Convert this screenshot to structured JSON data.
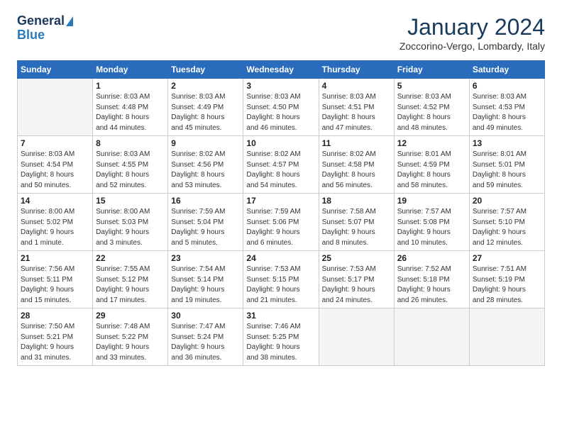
{
  "header": {
    "logo_general": "General",
    "logo_blue": "Blue",
    "month_title": "January 2024",
    "location": "Zoccorino-Vergo, Lombardy, Italy"
  },
  "days_of_week": [
    "Sunday",
    "Monday",
    "Tuesday",
    "Wednesday",
    "Thursday",
    "Friday",
    "Saturday"
  ],
  "weeks": [
    [
      {
        "day": "",
        "empty": true
      },
      {
        "day": "1",
        "info": "Sunrise: 8:03 AM\nSunset: 4:48 PM\nDaylight: 8 hours\nand 44 minutes."
      },
      {
        "day": "2",
        "info": "Sunrise: 8:03 AM\nSunset: 4:49 PM\nDaylight: 8 hours\nand 45 minutes."
      },
      {
        "day": "3",
        "info": "Sunrise: 8:03 AM\nSunset: 4:50 PM\nDaylight: 8 hours\nand 46 minutes."
      },
      {
        "day": "4",
        "info": "Sunrise: 8:03 AM\nSunset: 4:51 PM\nDaylight: 8 hours\nand 47 minutes."
      },
      {
        "day": "5",
        "info": "Sunrise: 8:03 AM\nSunset: 4:52 PM\nDaylight: 8 hours\nand 48 minutes."
      },
      {
        "day": "6",
        "info": "Sunrise: 8:03 AM\nSunset: 4:53 PM\nDaylight: 8 hours\nand 49 minutes."
      }
    ],
    [
      {
        "day": "7",
        "info": "Sunrise: 8:03 AM\nSunset: 4:54 PM\nDaylight: 8 hours\nand 50 minutes."
      },
      {
        "day": "8",
        "info": "Sunrise: 8:03 AM\nSunset: 4:55 PM\nDaylight: 8 hours\nand 52 minutes."
      },
      {
        "day": "9",
        "info": "Sunrise: 8:02 AM\nSunset: 4:56 PM\nDaylight: 8 hours\nand 53 minutes."
      },
      {
        "day": "10",
        "info": "Sunrise: 8:02 AM\nSunset: 4:57 PM\nDaylight: 8 hours\nand 54 minutes."
      },
      {
        "day": "11",
        "info": "Sunrise: 8:02 AM\nSunset: 4:58 PM\nDaylight: 8 hours\nand 56 minutes."
      },
      {
        "day": "12",
        "info": "Sunrise: 8:01 AM\nSunset: 4:59 PM\nDaylight: 8 hours\nand 58 minutes."
      },
      {
        "day": "13",
        "info": "Sunrise: 8:01 AM\nSunset: 5:01 PM\nDaylight: 8 hours\nand 59 minutes."
      }
    ],
    [
      {
        "day": "14",
        "info": "Sunrise: 8:00 AM\nSunset: 5:02 PM\nDaylight: 9 hours\nand 1 minute."
      },
      {
        "day": "15",
        "info": "Sunrise: 8:00 AM\nSunset: 5:03 PM\nDaylight: 9 hours\nand 3 minutes."
      },
      {
        "day": "16",
        "info": "Sunrise: 7:59 AM\nSunset: 5:04 PM\nDaylight: 9 hours\nand 5 minutes."
      },
      {
        "day": "17",
        "info": "Sunrise: 7:59 AM\nSunset: 5:06 PM\nDaylight: 9 hours\nand 6 minutes."
      },
      {
        "day": "18",
        "info": "Sunrise: 7:58 AM\nSunset: 5:07 PM\nDaylight: 9 hours\nand 8 minutes."
      },
      {
        "day": "19",
        "info": "Sunrise: 7:57 AM\nSunset: 5:08 PM\nDaylight: 9 hours\nand 10 minutes."
      },
      {
        "day": "20",
        "info": "Sunrise: 7:57 AM\nSunset: 5:10 PM\nDaylight: 9 hours\nand 12 minutes."
      }
    ],
    [
      {
        "day": "21",
        "info": "Sunrise: 7:56 AM\nSunset: 5:11 PM\nDaylight: 9 hours\nand 15 minutes."
      },
      {
        "day": "22",
        "info": "Sunrise: 7:55 AM\nSunset: 5:12 PM\nDaylight: 9 hours\nand 17 minutes."
      },
      {
        "day": "23",
        "info": "Sunrise: 7:54 AM\nSunset: 5:14 PM\nDaylight: 9 hours\nand 19 minutes."
      },
      {
        "day": "24",
        "info": "Sunrise: 7:53 AM\nSunset: 5:15 PM\nDaylight: 9 hours\nand 21 minutes."
      },
      {
        "day": "25",
        "info": "Sunrise: 7:53 AM\nSunset: 5:17 PM\nDaylight: 9 hours\nand 24 minutes."
      },
      {
        "day": "26",
        "info": "Sunrise: 7:52 AM\nSunset: 5:18 PM\nDaylight: 9 hours\nand 26 minutes."
      },
      {
        "day": "27",
        "info": "Sunrise: 7:51 AM\nSunset: 5:19 PM\nDaylight: 9 hours\nand 28 minutes."
      }
    ],
    [
      {
        "day": "28",
        "info": "Sunrise: 7:50 AM\nSunset: 5:21 PM\nDaylight: 9 hours\nand 31 minutes."
      },
      {
        "day": "29",
        "info": "Sunrise: 7:48 AM\nSunset: 5:22 PM\nDaylight: 9 hours\nand 33 minutes."
      },
      {
        "day": "30",
        "info": "Sunrise: 7:47 AM\nSunset: 5:24 PM\nDaylight: 9 hours\nand 36 minutes."
      },
      {
        "day": "31",
        "info": "Sunrise: 7:46 AM\nSunset: 5:25 PM\nDaylight: 9 hours\nand 38 minutes."
      },
      {
        "day": "",
        "empty": true
      },
      {
        "day": "",
        "empty": true
      },
      {
        "day": "",
        "empty": true
      }
    ]
  ]
}
